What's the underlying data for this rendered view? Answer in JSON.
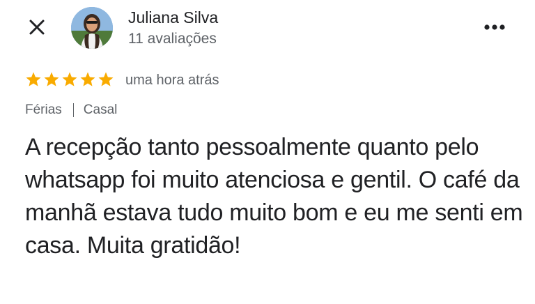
{
  "header": {
    "close_icon": "close-icon",
    "more_icon": "more-vertical-dots-icon",
    "avatar_icon": "reviewer-photo"
  },
  "reviewer": {
    "name": "Juliana Silva",
    "reviews_count": "11 avaliações"
  },
  "review": {
    "rating": 5,
    "max_rating": 5,
    "star_color": "#F9AB00",
    "time": "uma hora atrás",
    "tags": [
      "Férias",
      "Casal"
    ],
    "text": "A recepção tanto pessoalmente quanto pelo whatsapp foi muito atenciosa e gentil. O café da manhã estava tudo muito bom e eu me senti em casa. Muita gratidão!"
  }
}
